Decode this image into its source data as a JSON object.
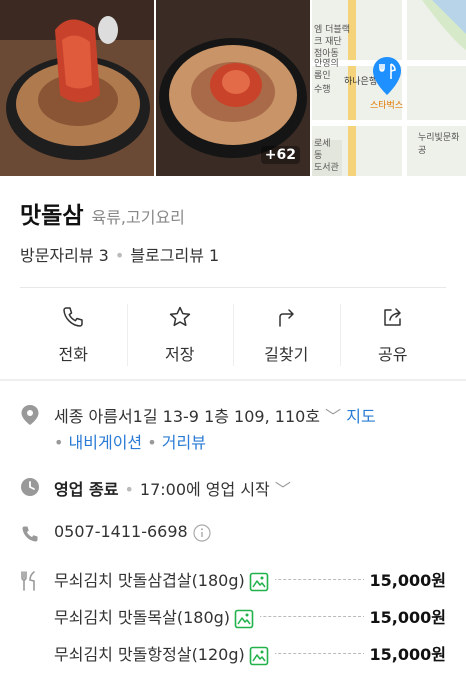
{
  "photos": {
    "more_count": "+62"
  },
  "map": {
    "labels": [
      "엠 더블랙",
      "크 재단",
      "점아동",
      "수행",
      "안영의",
      "롬인",
      "하나은행",
      "스타벅스",
      "누리빛문화공",
      "로세",
      "동",
      "도서관"
    ]
  },
  "place": {
    "name": "맛돌삼",
    "category": "육류,고기요리"
  },
  "reviews": {
    "visitor": "방문자리뷰 3",
    "blog": "블로그리뷰 1"
  },
  "actions": [
    {
      "label": "전화",
      "icon": "phone-icon"
    },
    {
      "label": "저장",
      "icon": "star-icon"
    },
    {
      "label": "길찾기",
      "icon": "directions-icon"
    },
    {
      "label": "공유",
      "icon": "share-icon"
    }
  ],
  "address": {
    "text": "세종 아름서1길 13-9 1층 109, 110호",
    "map_link": "지도",
    "navi_link": "내비게이션",
    "street_link": "거리뷰"
  },
  "hours": {
    "status": "영업 종료",
    "next": "17:00에 영업 시작"
  },
  "phone": {
    "number": "0507-1411-6698"
  },
  "menu": [
    {
      "name": "무쇠김치 맛돌삼겹살(180g)",
      "price": "15,000원"
    },
    {
      "name": "무쇠김치 맛돌목살(180g)",
      "price": "15,000원"
    },
    {
      "name": "무쇠김치 맛돌항정살(120g)",
      "price": "15,000원"
    }
  ],
  "colors": {
    "link": "#2a7bd6",
    "map_pin": "#1e90ff",
    "menu_image_icon": "#21b24b"
  }
}
